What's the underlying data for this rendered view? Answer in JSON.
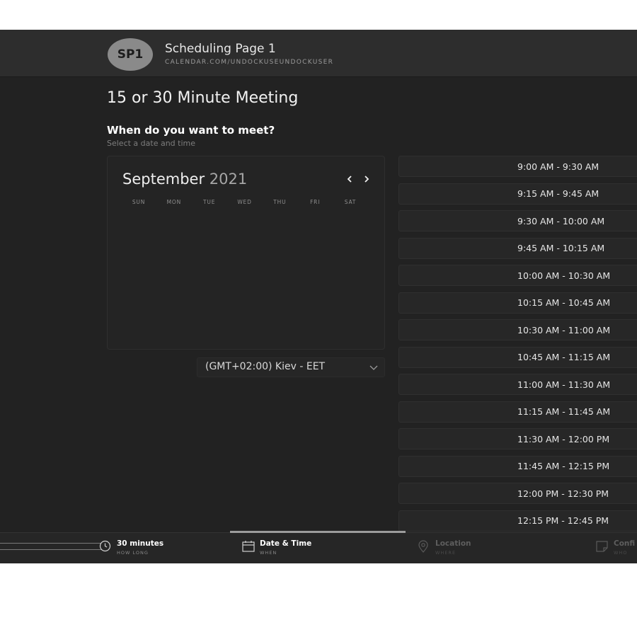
{
  "header": {
    "avatar_initials": "SP1",
    "page_name": "Scheduling Page 1",
    "page_url": "CALENDAR.COM/UNDOCKUSEUNDOCKUSER"
  },
  "meeting": {
    "title": "15 or 30 Minute Meeting",
    "question": "When do you want to meet?",
    "hint": "Select a date and time"
  },
  "calendar": {
    "month": "September",
    "year": "2021",
    "weekdays": [
      "SUN",
      "MON",
      "TUE",
      "WED",
      "THU",
      "FRI",
      "SAT"
    ]
  },
  "timezone": {
    "selected": "(GMT+02:00) Kiev - EET"
  },
  "time_slots": [
    "9:00 AM - 9:30 AM",
    "9:15 AM - 9:45 AM",
    "9:30 AM - 10:00 AM",
    "9:45 AM - 10:15 AM",
    "10:00 AM - 10:30 AM",
    "10:15 AM - 10:45 AM",
    "10:30 AM - 11:00 AM",
    "10:45 AM - 11:15 AM",
    "11:00 AM - 11:30 AM",
    "11:15 AM - 11:45 AM",
    "11:30 AM - 12:00 PM",
    "11:45 AM - 12:15 PM",
    "12:00 PM - 12:30 PM",
    "12:15 PM - 12:45 PM"
  ],
  "steps": [
    {
      "label": "30 minutes",
      "sub": "HOW LONG",
      "icon": "clock-icon"
    },
    {
      "label": "Date & Time",
      "sub": "WHEN",
      "icon": "calendar-icon",
      "active": true
    },
    {
      "label": "Location",
      "sub": "WHERE",
      "icon": "location-pin-icon"
    },
    {
      "label": "Confi",
      "sub": "WHO",
      "icon": "note-icon"
    }
  ],
  "colors": {
    "background": "#222222",
    "header": "#2d2d2d",
    "avatar": "#8a8a8a",
    "slot": "#272727",
    "active_step": "#9c9c9c"
  }
}
